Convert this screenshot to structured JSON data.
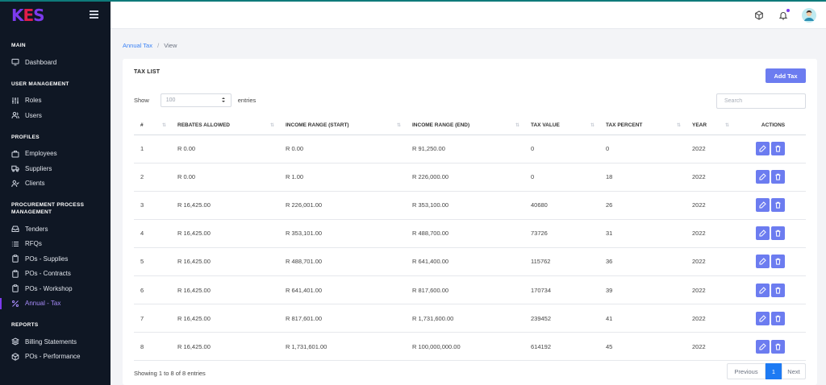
{
  "brand": {
    "logo_k": "K",
    "logo_e": "E",
    "logo_s": "S"
  },
  "sidebar": {
    "sections": [
      {
        "title": "MAIN",
        "items": [
          {
            "label": "Dashboard",
            "icon": "monitor-icon"
          }
        ]
      },
      {
        "title": "USER MANAGEMENT",
        "items": [
          {
            "label": "Roles",
            "icon": "sliders-icon"
          },
          {
            "label": "Users",
            "icon": "users-icon"
          }
        ]
      },
      {
        "title": "PROFILES",
        "items": [
          {
            "label": "Employees",
            "icon": "briefcase-icon"
          },
          {
            "label": "Suppliers",
            "icon": "truck-icon"
          },
          {
            "label": "Clients",
            "icon": "user-check-icon"
          }
        ]
      },
      {
        "title_line1": "PROCUREMENT PROCESS",
        "title_line2": "MANAGEMENT",
        "items": [
          {
            "label": "Tenders",
            "icon": "inbox-icon"
          },
          {
            "label": "RFQs",
            "icon": "list-icon"
          },
          {
            "label": "POs - Supplies",
            "icon": "clipboard-icon"
          },
          {
            "label": "POs - Contracts",
            "icon": "clipboard-icon"
          },
          {
            "label": "POs - Workshop",
            "icon": "clipboard-icon"
          },
          {
            "label": "Annual - Tax",
            "icon": "percent-icon",
            "active": true
          }
        ]
      },
      {
        "title": "REPORTS",
        "items": [
          {
            "label": "Billing Statements",
            "icon": "layers-icon"
          },
          {
            "label": "POs - Performance",
            "icon": "codesandbox-icon"
          }
        ]
      }
    ]
  },
  "breadcrumb": {
    "parent": "Annual Tax",
    "separator": "/",
    "current": "View"
  },
  "card": {
    "title": "TAX LIST",
    "add_button": "Add Tax",
    "show_label": "Show",
    "entries_select_value": "100",
    "entries_label": "entries",
    "search_placeholder": "Search"
  },
  "table": {
    "headers": [
      "#",
      "REBATES ALLOWED",
      "INCOME RANGE (START)",
      "INCOME RANGE (END)",
      "TAX VALUE",
      "TAX PERCENT",
      "YEAR",
      "ACTIONS"
    ],
    "rows": [
      [
        "1",
        "R 0.00",
        "R 0.00",
        "R 91,250.00",
        "0",
        "0",
        "2022"
      ],
      [
        "2",
        "R 0.00",
        "R 1.00",
        "R 226,000.00",
        "0",
        "18",
        "2022"
      ],
      [
        "3",
        "R 16,425.00",
        "R 226,001.00",
        "R 353,100.00",
        "40680",
        "26",
        "2022"
      ],
      [
        "4",
        "R 16,425.00",
        "R 353,101.00",
        "R 488,700.00",
        "73726",
        "31",
        "2022"
      ],
      [
        "5",
        "R 16,425.00",
        "R 488,701.00",
        "R 641,400.00",
        "115762",
        "36",
        "2022"
      ],
      [
        "6",
        "R 16,425.00",
        "R 641,401.00",
        "R 817,600.00",
        "170734",
        "39",
        "2022"
      ],
      [
        "7",
        "R 16,425.00",
        "R 817,601.00",
        "R 1,731,600.00",
        "239452",
        "41",
        "2022"
      ],
      [
        "8",
        "R 16,425.00",
        "R 1,731,601.00",
        "R 100,000,000.00",
        "614192",
        "45",
        "2022"
      ]
    ]
  },
  "footer": {
    "info": "Showing 1 to 8 of 8 entries",
    "prev": "Previous",
    "page": "1",
    "next": "Next"
  },
  "colors": {
    "accent": "#6c7cf0",
    "sidebar_bg": "#0f1724",
    "active_page": "#1d7af3"
  }
}
